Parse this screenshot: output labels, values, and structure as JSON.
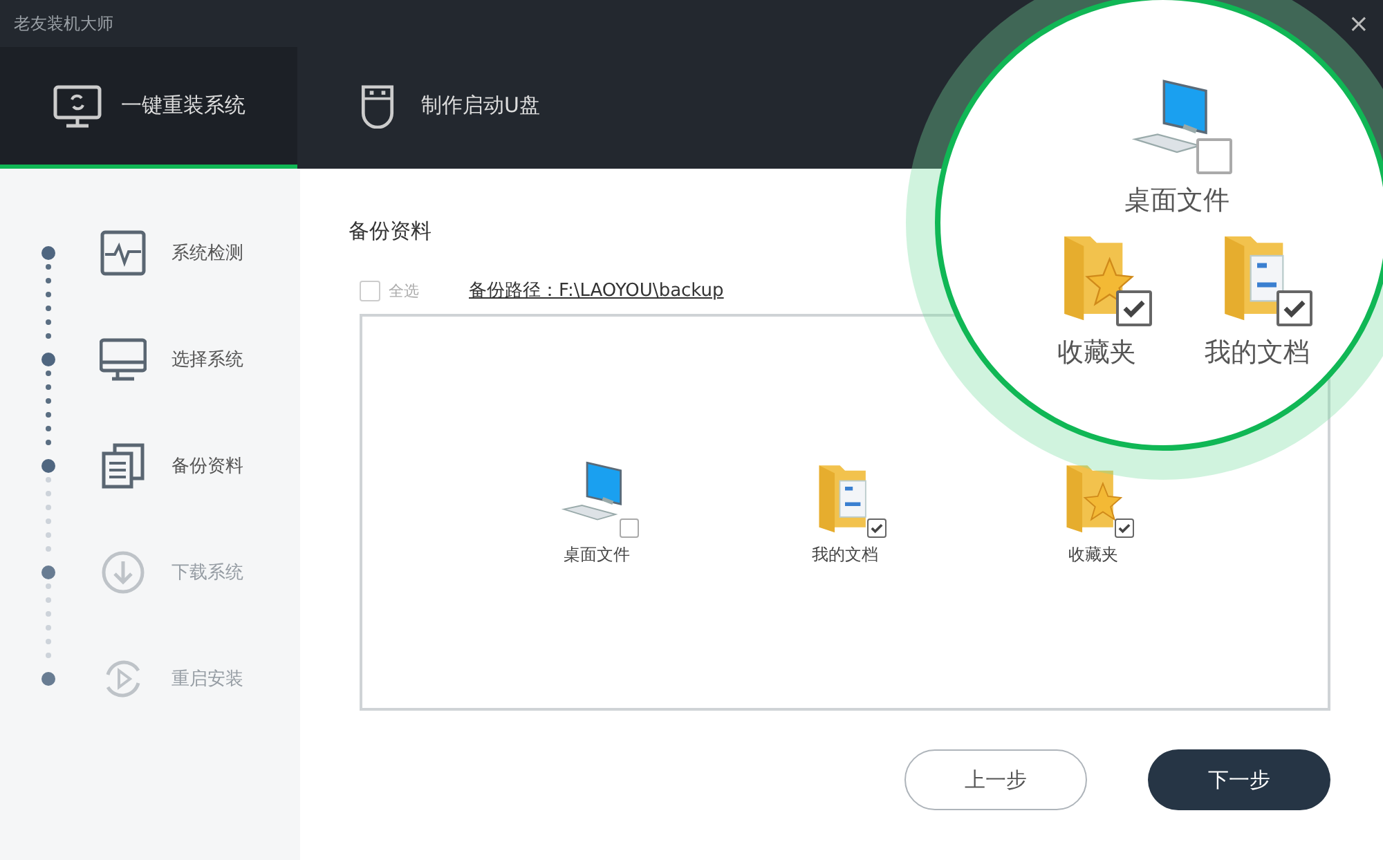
{
  "window": {
    "title": "老友装机大师",
    "close": "×"
  },
  "tabs": [
    {
      "label": "一键重装系统",
      "selected": true,
      "kind": "reinstall"
    },
    {
      "label": "制作启动U盘",
      "selected": false,
      "kind": "usb"
    }
  ],
  "steps": [
    {
      "label": "系统检测",
      "done": true,
      "kind": "detect"
    },
    {
      "label": "选择系统",
      "done": true,
      "kind": "monitor"
    },
    {
      "label": "备份资料",
      "done": true,
      "kind": "backup"
    },
    {
      "label": "下载系统",
      "done": false,
      "kind": "download"
    },
    {
      "label": "重启安装",
      "done": false,
      "kind": "restart"
    }
  ],
  "backup": {
    "title": "备份资料",
    "select_all": {
      "label": "全选",
      "checked": false
    },
    "path": "备份路径：F:\\LAOYOU\\backup",
    "items": [
      {
        "label": "桌面文件",
        "checked": false,
        "kind": "desktop"
      },
      {
        "label": "我的文档",
        "checked": true,
        "kind": "documents"
      },
      {
        "label": "收藏夹",
        "checked": true,
        "kind": "favorites"
      }
    ]
  },
  "magnifier": {
    "items": [
      {
        "label": "桌面文件",
        "checked": false,
        "kind": "desktop"
      },
      {
        "label": "收藏夹",
        "checked": true,
        "kind": "favorites"
      },
      {
        "label": "我的文档",
        "checked": true,
        "kind": "documents"
      }
    ]
  },
  "buttons": [
    {
      "label": "上一步",
      "kind": "secondary"
    },
    {
      "label": "下一步",
      "kind": "primary"
    }
  ]
}
